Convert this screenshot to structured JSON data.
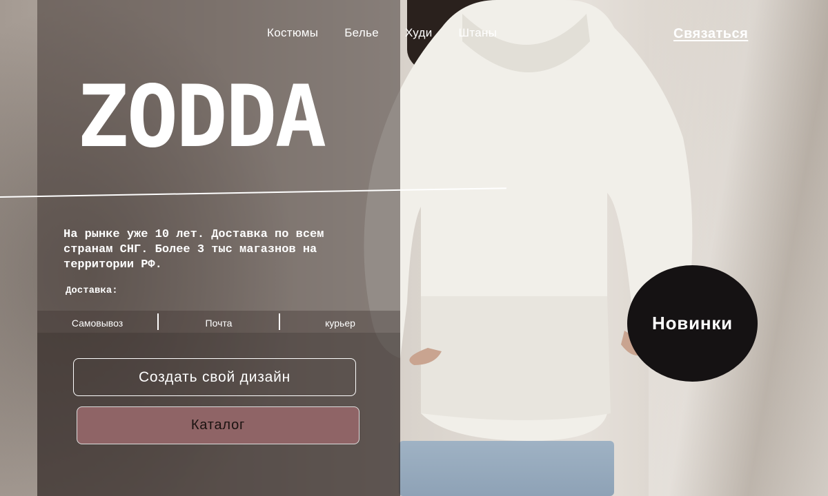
{
  "nav": {
    "items": [
      "Костюмы",
      "Белье",
      "Худи",
      "Штаны"
    ],
    "contact_label": "Связаться"
  },
  "hero": {
    "brand": "ZODDA",
    "description": "На рынке уже 10 лет. Доставка по всем странам СНГ. Более 3 тыс магазнов на территории РФ."
  },
  "delivery": {
    "label": "Доставка:",
    "options": [
      "Самовывоз",
      "Почта",
      "курьер"
    ]
  },
  "buttons": {
    "create_design": "Создать свой дизайн",
    "catalog": "Каталог",
    "new_items": "Новинки"
  },
  "colors": {
    "catalog_button": "#8f6466",
    "new_circle": "#151213",
    "overlay": "#463a36"
  }
}
